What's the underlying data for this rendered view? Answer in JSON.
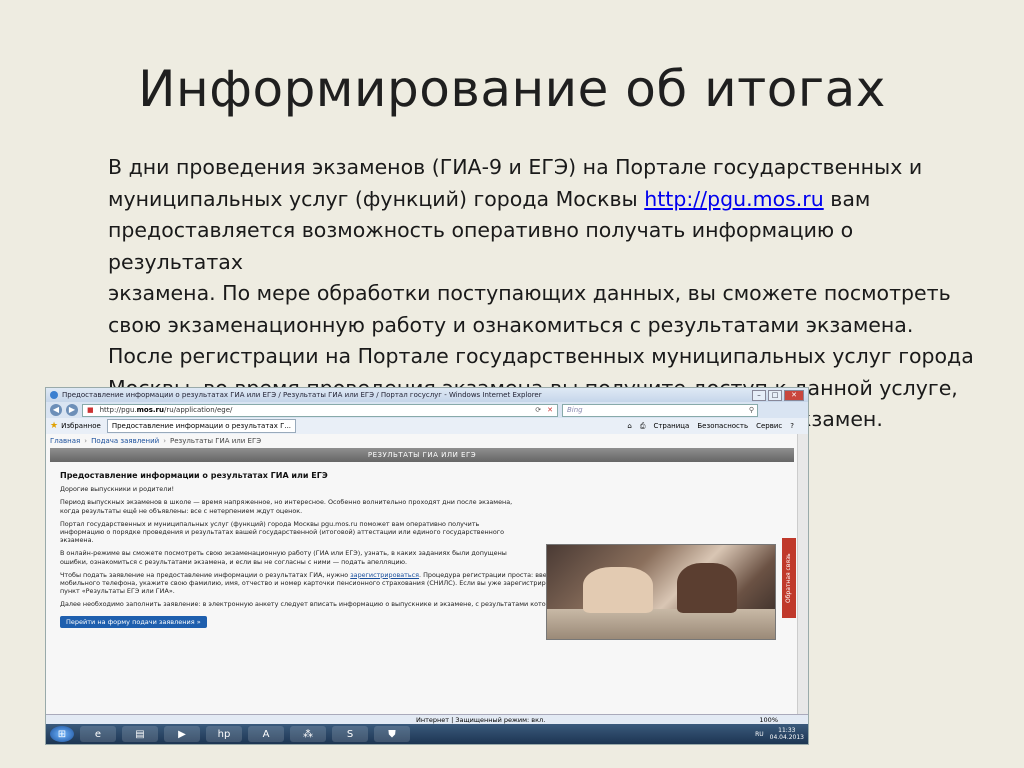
{
  "title": "Информирование об итогах",
  "body": {
    "line1": "В дни проведения экзаменов (ГИА-9 и ЕГЭ) на Портале государственных и",
    "line2_pre": "муниципальных услуг (функций) города Москвы ",
    "line2_link": "http://pgu.mos.ru",
    "line2_post": " вам",
    "line3": "предоставляется возможность оперативно получать информацию о результатах",
    "line4": "экзамена. По мере обработки поступающих данных, вы сможете посмотреть",
    "line5": "свою экзаменационную работу и ознакомиться с результатами экзамена.",
    "line6": "После регистрации на Портале государственных муниципальных услуг города",
    "line7": "Москвы, во время проведения экзамена вы получите доступ к данной услуге,",
    "line8": "введя логин и пароль, которые указаны в вашем пропуске на экзамен."
  },
  "browser": {
    "window_title": "Предоставление информации о результатах ГИА или ЕГЭ / Результаты ГИА или ЕГЭ / Портал госуслуг - Windows Internet Explorer",
    "url_prefix": "http://pgu.",
    "url_domain": "mos.ru",
    "url_suffix": "/ru/application/ege/",
    "search_placeholder": "Bing",
    "favorites_label": "Избранное",
    "tab_label": "Предоставление информации о результатах Г...",
    "cmd_page": "Страница",
    "cmd_safety": "Безопасность",
    "cmd_service": "Сервис",
    "breadcrumb": {
      "home": "Главная",
      "applications": "Подача заявлений",
      "current": "Результаты ГИА или ЕГЭ"
    },
    "banner": "РЕЗУЛЬТАТЫ ГИА ИЛИ ЕГЭ",
    "content": {
      "heading": "Предоставление информации о результатах ГИА или ЕГЭ",
      "greeting": "Дорогие выпускники и родители!",
      "p1": "Период выпускных экзаменов в школе — время напряженное, но интересное. Особенно волнительно проходят дни после экзамена, когда результаты ещё не объявлены: все с нетерпением ждут оценок.",
      "p2": "Портал государственных и муниципальных услуг (функций) города Москвы pgu.mos.ru поможет вам оперативно получить информацию о порядке проведения и результатах вашей государственной (итоговой) аттестации или единого государственного экзамена.",
      "p3": "В онлайн-режиме вы сможете посмотреть свою экзаменационную работу (ГИА или ЕГЭ), узнать, в каких заданиях были допущены ошибки, ознакомиться с результатами экзамена, и если вы не согласны с ними — подать апелляцию.",
      "p4_pre": "Чтобы подать заявление на предоставление информации о результатах ГИА, нужно ",
      "p4_link": "зарегистрироваться",
      "p4_post": ". Процедура регистрации проста: введите и подтвердите ваш электронный адрес и номер вашего мобильного телефона, укажите свою фамилию, имя, отчество и номер карточки пенсионного страхования (СНИЛС). Если вы уже зарегистрированы — зайдите под своим логином и паролем и выберите в меню пункт «Результаты ЕГЭ или ГИА».",
      "p5": "Далее необходимо заполнить заявление: в электронную анкету следует вписать информацию о выпускнике и экзамене, с результатами которого вы хотели бы ознакомиться.",
      "cta": "Перейти на форму подачи заявления »"
    },
    "feedback": "Обратная связь",
    "status_zone": "Интернет | Защищенный режим: вкл.",
    "zoom": "100%",
    "lang": "RU",
    "time": "11:33",
    "date": "04.04.2013"
  }
}
